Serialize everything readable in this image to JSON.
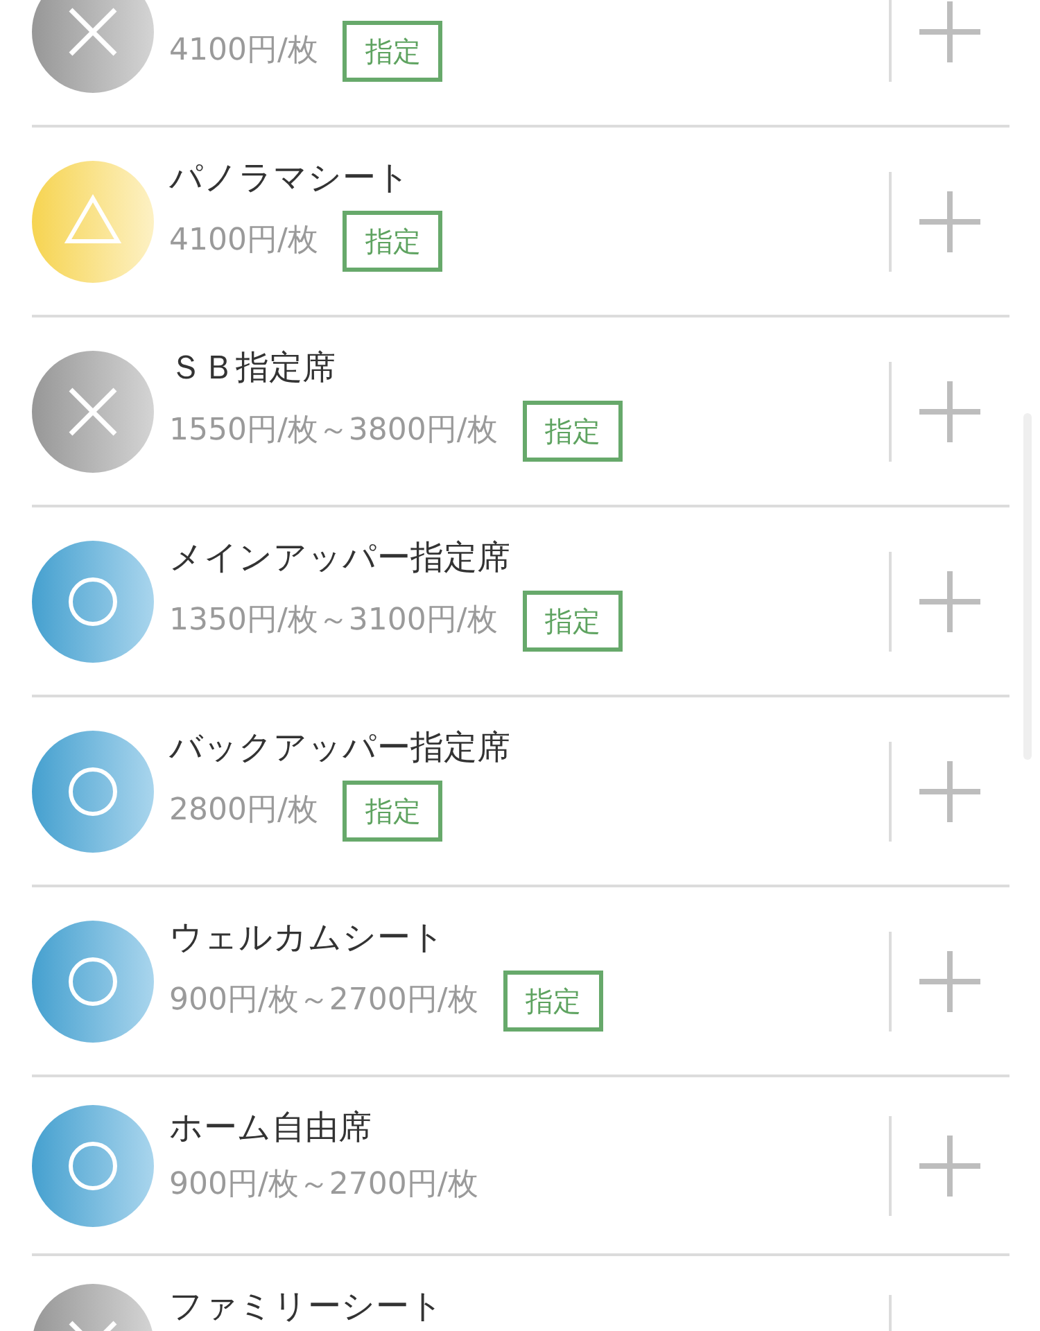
{
  "seats": [
    {
      "kind": "sold_out",
      "price": "4100円/枚",
      "badge": "指定"
    },
    {
      "name": "パノラマシート",
      "kind": "few",
      "price": "4100円/枚",
      "badge": "指定"
    },
    {
      "name": "ＳＢ指定席",
      "kind": "sold_out",
      "price": "1550円/枚～3800円/枚",
      "badge": "指定"
    },
    {
      "name": "メインアッパー指定席",
      "kind": "available",
      "price": "1350円/枚～3100円/枚",
      "badge": "指定"
    },
    {
      "name": "バックアッパー指定席",
      "kind": "available",
      "price": "2800円/枚",
      "badge": "指定"
    },
    {
      "name": "ウェルカムシート",
      "kind": "available",
      "price": "900円/枚～2700円/枚",
      "badge": "指定"
    },
    {
      "name": "ホーム自由席",
      "kind": "available",
      "price": "900円/枚～2700円/枚"
    },
    {
      "name": "ファミリーシート",
      "kind": "sold_out"
    }
  ]
}
